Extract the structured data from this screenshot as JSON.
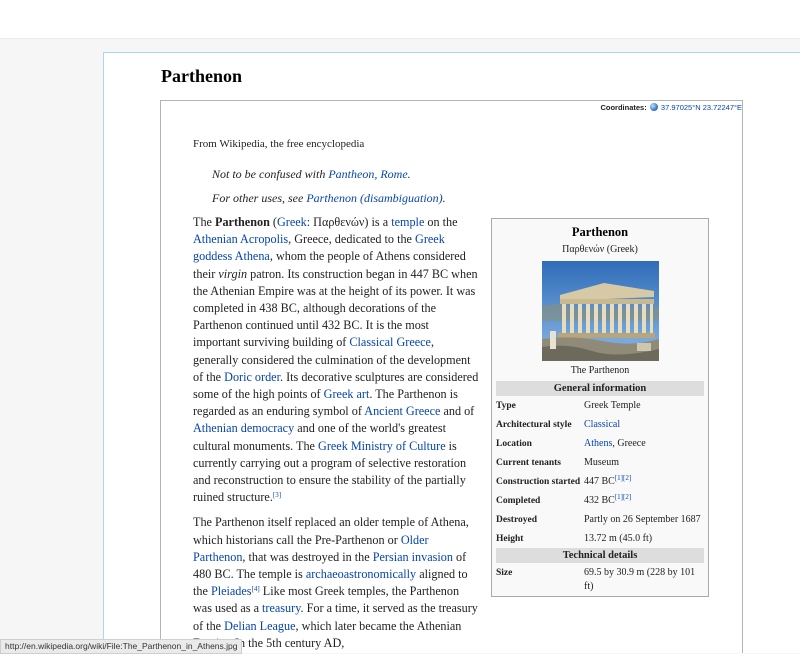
{
  "page": {
    "title": "Parthenon"
  },
  "coordinates": {
    "label": "Coordinates:",
    "value": "37.97025°N 23.72247°E"
  },
  "tagline": "From Wikipedia, the free encyclopedia",
  "hatnotes": [
    {
      "prefix": "Not to be confused with ",
      "link": "Pantheon, Rome",
      "suffix": "."
    },
    {
      "prefix": "For other uses, see ",
      "link": "Parthenon (disambiguation)",
      "suffix": "."
    }
  ],
  "article": {
    "p1": {
      "t1": "The ",
      "bold": "Parthenon",
      "t2": " (",
      "greek_link": "Greek",
      "t3": ": Παρθενών) is a ",
      "temple": "temple",
      "t4": " on the ",
      "acropolis": "Athenian Acropolis",
      "t5": ", Greece, dedicated to the ",
      "athena": "Greek goddess Athena",
      "t6": ", whom the people of Athens considered their ",
      "virgin": "virgin",
      "t7": " patron. Its construction began in 447 BC when the Athenian Empire was at the height of its power. It was completed in 438 BC, although decorations of the Parthenon continued until 432 BC. It is the most important surviving building of ",
      "classical_greece": "Classical Greece",
      "t8": ", generally considered the culmination of the development of the ",
      "doric": "Doric order",
      "t9": ". Its decorative sculptures are considered some of the high points of ",
      "greek_art": "Greek art",
      "t10": ". The Parthenon is regarded as an enduring symbol of ",
      "ancient_greece": "Ancient Greece",
      "t11": " and of ",
      "democracy": "Athenian democracy",
      "t12": " and one of the world's greatest cultural monuments. The ",
      "ministry": "Greek Ministry of Culture",
      "t13": " is currently carrying out a program of selective restoration and reconstruction to ensure the stability of the partially ruined structure.",
      "ref3": "[3]"
    },
    "p2": {
      "t1": "The Parthenon itself replaced an older temple of Athena, which historians call the Pre-Parthenon or ",
      "older": "Older Parthenon",
      "t2": ", that was destroyed in the ",
      "persian": "Persian invasion",
      "t3": " of 480 BC. The temple is ",
      "archaeo": "archaeoastronomically",
      "t4": " aligned to the ",
      "pleiades": "Pleiades",
      "ref4": "[4]",
      "t5": " Like most Greek temples, the Parthenon was used as a ",
      "treasury": "treasury",
      "t6": ". For a time, it served as the treasury of the ",
      "delian": "Delian League",
      "t7": ", which later became the Athenian Empire. In the 5th century AD,"
    }
  },
  "infobox": {
    "title": "Parthenon",
    "native": "Παρθενών (Greek)",
    "image_caption": "The Parthenon",
    "section_general": "General information",
    "rows": [
      {
        "k": "Type",
        "v": "Greek Temple"
      },
      {
        "k": "Architectural style",
        "v_link": "Classical"
      },
      {
        "k": "Location",
        "v_link": "Athens",
        "v_suffix": ", Greece"
      },
      {
        "k": "Current tenants",
        "v": "Museum"
      },
      {
        "k": "Construction started",
        "v": "447 BC",
        "refs": "[1][2]"
      },
      {
        "k": "Completed",
        "v": "432 BC",
        "refs": "[1][2]"
      },
      {
        "k": "Destroyed",
        "v": "Partly on 26 September 1687"
      },
      {
        "k": "Height",
        "v": "13.72 m (45.0 ft)"
      }
    ],
    "section_technical": "Technical details",
    "tech_rows": [
      {
        "k": "Size",
        "v": "69.5 by 30.9 m (228 by 101 ft)"
      }
    ]
  },
  "status_bar": "http://en.wikipedia.org/wiki/File:The_Parthenon_in_Athens.jpg"
}
